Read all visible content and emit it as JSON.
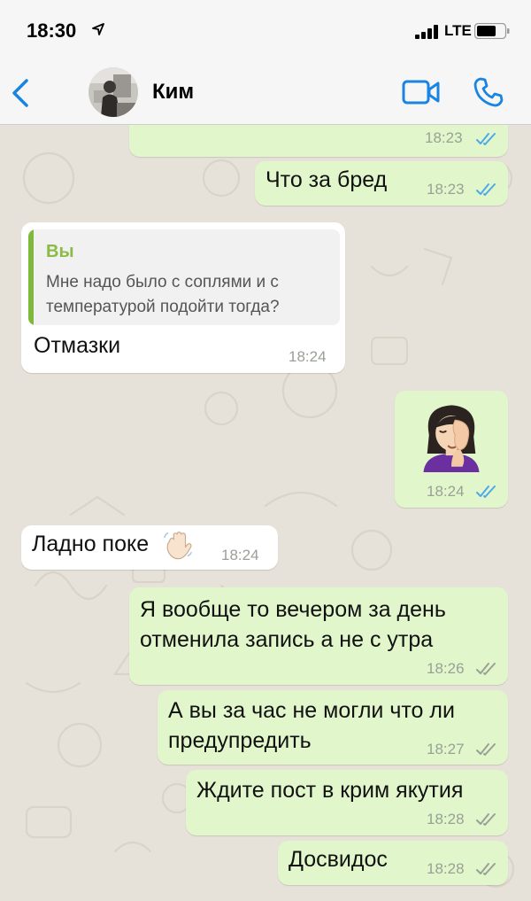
{
  "status_bar": {
    "time": "18:30",
    "network": "LTE",
    "location_icon": "location-arrow-icon",
    "signal_icon": "signal-bars-icon",
    "battery_icon": "battery-icon"
  },
  "header": {
    "contact_name": "Ким",
    "back_icon": "chevron-left-icon",
    "video_icon": "video-camera-icon",
    "call_icon": "phone-icon",
    "accent_color": "#1a85e0"
  },
  "messages": [
    {
      "direction": "out",
      "text": "",
      "time": "18:23",
      "status": "read"
    },
    {
      "direction": "out",
      "text": "Что за бред",
      "time": "18:23",
      "status": "read"
    },
    {
      "direction": "in",
      "quote": {
        "author": "Вы",
        "text": "Мне надо было с соплями и с температурой подойти тогда?"
      },
      "text": "Отмазки",
      "time": "18:24"
    },
    {
      "direction": "out",
      "emoji": "face-palm-woman-emoji",
      "time": "18:24",
      "status": "read"
    },
    {
      "direction": "in",
      "text": "Ладно поке",
      "emoji": "waving-hand-emoji",
      "time": "18:24"
    },
    {
      "direction": "out",
      "lines": [
        "Я вообще то вечером за день",
        "отменила запись а не с утра"
      ],
      "time": "18:26",
      "status": "delivered"
    },
    {
      "direction": "out",
      "lines": [
        "А вы за час не могли что ли",
        "предупредить"
      ],
      "time": "18:27",
      "status": "delivered"
    },
    {
      "direction": "out",
      "text": "Ждите пост в крим якутия",
      "time": "18:28",
      "status": "delivered"
    },
    {
      "direction": "out",
      "text": "Досвидос",
      "time": "18:28",
      "status": "delivered"
    }
  ],
  "colors": {
    "outgoing_bubble": "#e1f7cb",
    "incoming_bubble": "#ffffff",
    "read_ticks": "#4fa8e8",
    "delivered_ticks": "#9aa096",
    "quote_accent": "#7fb83a",
    "wallpaper": "#e7e2d9"
  }
}
